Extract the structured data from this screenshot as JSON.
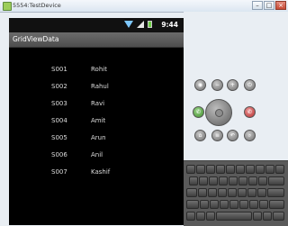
{
  "window": {
    "title": "5554:TestDevice"
  },
  "statusbar": {
    "time": "9:44"
  },
  "app": {
    "title": "GridViewData"
  },
  "rows": [
    {
      "id": "S001",
      "name": "Rohit"
    },
    {
      "id": "S002",
      "name": "Rahul"
    },
    {
      "id": "S003",
      "name": "Ravi"
    },
    {
      "id": "S004",
      "name": "Amit"
    },
    {
      "id": "S005",
      "name": "Arun"
    },
    {
      "id": "S006",
      "name": "Anil"
    },
    {
      "id": "S007",
      "name": "Kashif"
    }
  ],
  "icons": {
    "window_controls": [
      "minimize-icon",
      "maximize-icon",
      "close-icon"
    ],
    "hardware_buttons": [
      "camera-icon",
      "volume-down-icon",
      "volume-up-icon",
      "power-icon",
      "call-icon",
      "end-call-icon",
      "home-icon",
      "menu-icon",
      "back-icon",
      "search-icon"
    ]
  },
  "colors": {
    "window_bg": "#e9eef3",
    "screen_bg": "#000000",
    "title_bar": "#5a5a5a",
    "call": "#3f8d2c",
    "end_call": "#b22d2d",
    "battery": "#6fd146"
  }
}
